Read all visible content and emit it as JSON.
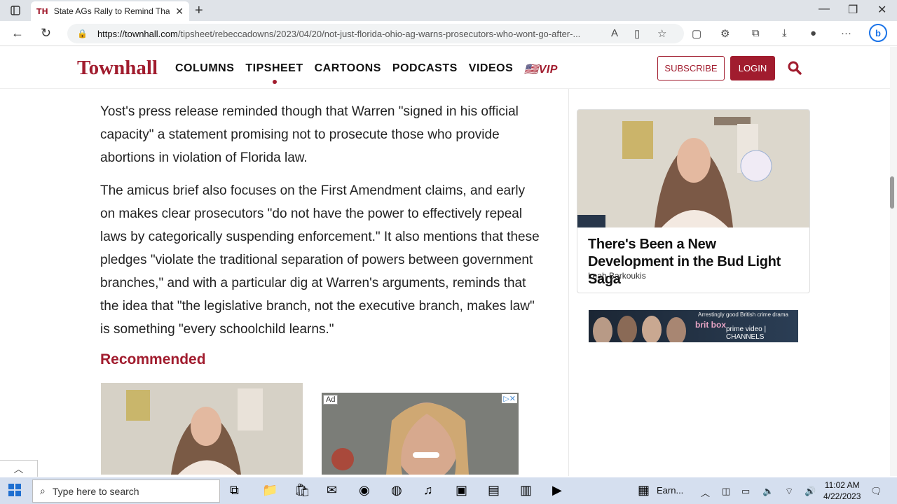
{
  "browser": {
    "tab_title": "State AGs Rally to Remind That P",
    "tab_favicon": "TH",
    "url_host": "https://townhall.com",
    "url_path": "/tipsheet/rebeccadowns/2023/04/20/not-just-florida-ohio-ag-warns-prosecutors-who-wont-go-after-..."
  },
  "site": {
    "logo": "Townhall",
    "nav": [
      "COLUMNS",
      "TIPSHEET",
      "CARTOONS",
      "PODCASTS",
      "VIDEOS"
    ],
    "vip": "🇺🇸VIP",
    "subscribe": "SUBSCRIBE",
    "login": "LOGIN",
    "brand_color": "#a11c2e"
  },
  "article": {
    "paragraphs": [
      "Yost's press release reminded though that Warren \"signed in his official capacity\" a statement promising not to prosecute those who provide abortions in violation of Florida law.",
      "The amicus brief also focuses on the First Amendment claims, and early on makes clear prosecutors \"do not have the power to effectively repeal laws by categorically suspending enforcement.\" It also mentions that these pledges \"violate the traditional separation of powers between government branches,\" and with a particular dig at Warren's arguments, reminds that the idea that \"the legislative branch, not the executive branch, makes law\" is something \"every schoolchild learns.\""
    ],
    "recommended": "Recommended",
    "ad_label": "Ad"
  },
  "sidebar": {
    "headline": "There's Been a New Development in the Bud Light Saga",
    "author": "Leah Barkoukis",
    "banner_tagline": "Arrestingly good British crime drama",
    "banner_brand": "brit box",
    "banner_channel": "prime video | CHANNELS"
  },
  "taskbar": {
    "search_placeholder": "Type here to search",
    "earnings_label": "Earn...",
    "time": "11:02 AM",
    "date": "4/22/2023"
  }
}
